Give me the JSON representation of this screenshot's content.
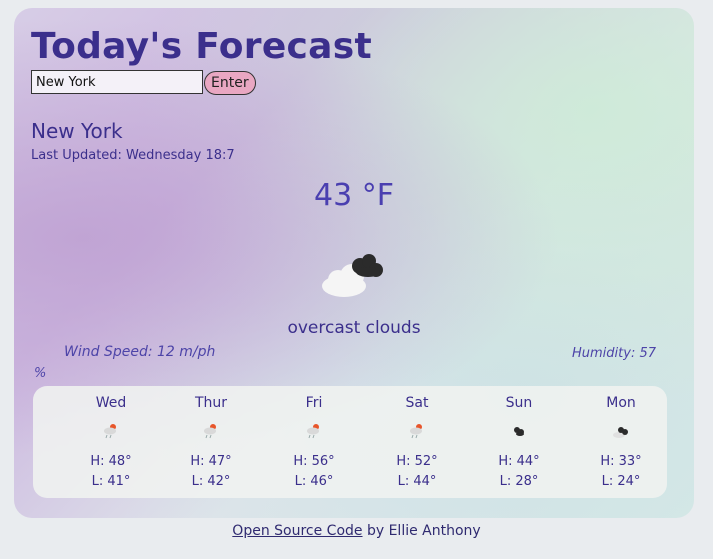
{
  "header": {
    "title": "Today's Forecast"
  },
  "search": {
    "value": "New York",
    "enter_label": "Enter"
  },
  "current": {
    "city": "New York",
    "last_updated": "Last Updated: Wednesday 18:7",
    "temperature": "43 °F",
    "description": "overcast clouds",
    "icon": "overcast-clouds-icon",
    "wind_speed": "Wind Speed: 12 m/ph",
    "humidity": "Humidity: 57",
    "humidity_unit": "%"
  },
  "forecast": [
    {
      "day": "Wed",
      "high": "H: 48°",
      "low": "L: 41°",
      "icon": "light-rain-icon"
    },
    {
      "day": "Thur",
      "high": "H: 47°",
      "low": "L: 42°",
      "icon": "light-rain-icon"
    },
    {
      "day": "Fri",
      "high": "H: 56°",
      "low": "L: 46°",
      "icon": "light-rain-icon"
    },
    {
      "day": "Sat",
      "high": "H: 52°",
      "low": "L: 44°",
      "icon": "light-rain-icon"
    },
    {
      "day": "Sun",
      "high": "H: 44°",
      "low": "L: 28°",
      "icon": "broken-clouds-icon"
    },
    {
      "day": "Mon",
      "high": "H: 33°",
      "low": "L: 24°",
      "icon": "overcast-clouds-icon"
    }
  ],
  "footer": {
    "link_text": "Open Source Code",
    "suffix": " by Ellie Anthony"
  },
  "colors": {
    "accent": "#3b2f8c",
    "button": "#e9a7c2"
  }
}
